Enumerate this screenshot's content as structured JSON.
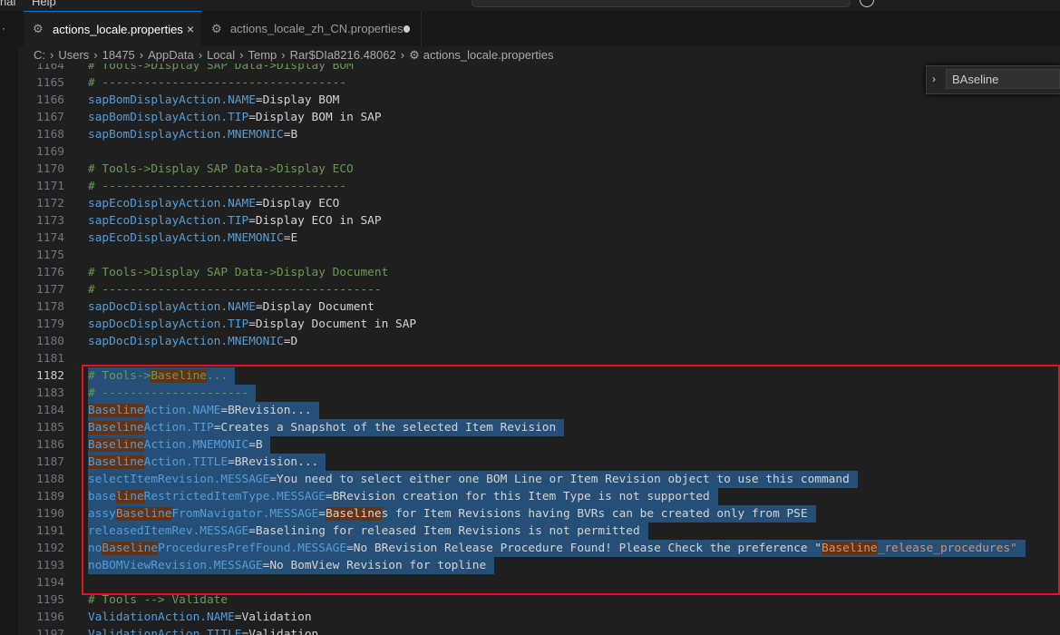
{
  "menu": {
    "items": [
      "nal",
      "Help"
    ]
  },
  "tabs": [
    {
      "label": "actions_locale.properties",
      "active": true,
      "close": "×"
    },
    {
      "label": "actions_locale_zh_CN.properties",
      "active": false,
      "modified": true
    }
  ],
  "breadcrumb": [
    "C:",
    "Users",
    "18475",
    "AppData",
    "Local",
    "Temp",
    "Rar$DIa8216.48062",
    "actions_locale.properties"
  ],
  "find": {
    "value": "BAseline",
    "chevron": "›"
  },
  "editor": {
    "current_line": "1182",
    "lines": [
      {
        "n": "1164",
        "kind": "comment",
        "text": "# Tools->Display SAP Data->Display BOM"
      },
      {
        "n": "1165",
        "kind": "comment",
        "text": "# -----------------------------------"
      },
      {
        "n": "1166",
        "kind": "prop",
        "key": "sapBomDisplayAction",
        "attr": ".NAME",
        "val": "Display BOM"
      },
      {
        "n": "1167",
        "kind": "prop",
        "key": "sapBomDisplayAction",
        "attr": ".TIP",
        "val": "Display BOM in SAP"
      },
      {
        "n": "1168",
        "kind": "prop",
        "key": "sapBomDisplayAction",
        "attr": ".MNEMONIC",
        "val": "B"
      },
      {
        "n": "1169",
        "kind": "blank",
        "text": ""
      },
      {
        "n": "1170",
        "kind": "comment",
        "text": "# Tools->Display SAP Data->Display ECO"
      },
      {
        "n": "1171",
        "kind": "comment",
        "text": "# -----------------------------------"
      },
      {
        "n": "1172",
        "kind": "prop",
        "key": "sapEcoDisplayAction",
        "attr": ".NAME",
        "val": "Display ECO"
      },
      {
        "n": "1173",
        "kind": "prop",
        "key": "sapEcoDisplayAction",
        "attr": ".TIP",
        "val": "Display ECO in SAP"
      },
      {
        "n": "1174",
        "kind": "prop",
        "key": "sapEcoDisplayAction",
        "attr": ".MNEMONIC",
        "val": "E"
      },
      {
        "n": "1175",
        "kind": "blank",
        "text": ""
      },
      {
        "n": "1176",
        "kind": "comment",
        "text": "# Tools->Display SAP Data->Display Document"
      },
      {
        "n": "1177",
        "kind": "comment",
        "text": "# ----------------------------------------"
      },
      {
        "n": "1178",
        "kind": "prop",
        "key": "sapDocDisplayAction",
        "attr": ".NAME",
        "val": "Display Document"
      },
      {
        "n": "1179",
        "kind": "prop",
        "key": "sapDocDisplayAction",
        "attr": ".TIP",
        "val": "Display Document in SAP"
      },
      {
        "n": "1180",
        "kind": "prop",
        "key": "sapDocDisplayAction",
        "attr": ".MNEMONIC",
        "val": "D"
      },
      {
        "n": "1181",
        "kind": "blank",
        "text": ""
      },
      {
        "n": "1182",
        "kind": "sel",
        "segs": [
          [
            "cm",
            "# Tools->"
          ],
          [
            "cmh",
            "Baseline"
          ],
          [
            "cm",
            "..."
          ]
        ]
      },
      {
        "n": "1183",
        "kind": "sel",
        "segs": [
          [
            "cm",
            "# ---------------------"
          ]
        ]
      },
      {
        "n": "1184",
        "kind": "sel",
        "segs": [
          [
            "keyh",
            "Baseline"
          ],
          [
            "key",
            "Action.NAME"
          ],
          [
            "val",
            "=BRevision..."
          ]
        ]
      },
      {
        "n": "1185",
        "kind": "sel",
        "segs": [
          [
            "keyh",
            "Baseline"
          ],
          [
            "key",
            "Action.TIP"
          ],
          [
            "val",
            "=Creates a Snapshot of the selected Item Revision"
          ]
        ]
      },
      {
        "n": "1186",
        "kind": "sel",
        "segs": [
          [
            "keyh",
            "Baseline"
          ],
          [
            "key",
            "Action.MNEMONIC"
          ],
          [
            "val",
            "=B"
          ]
        ]
      },
      {
        "n": "1187",
        "kind": "sel",
        "segs": [
          [
            "keyh",
            "Baseline"
          ],
          [
            "key",
            "Action.TITLE"
          ],
          [
            "val",
            "=BRevision..."
          ]
        ]
      },
      {
        "n": "1188",
        "kind": "sel",
        "segs": [
          [
            "key",
            "selectItemRevision.MESSAGE"
          ],
          [
            "val",
            "=You need to select either one BOM Line or Item Revision object to use this command"
          ]
        ]
      },
      {
        "n": "1189",
        "kind": "sel",
        "segs": [
          [
            "key",
            "base"
          ],
          [
            "keyh",
            "line"
          ],
          [
            "key",
            "RestrictedItemType.MESSAGE"
          ],
          [
            "val",
            "=BRevision creation for this Item Type is not supported"
          ]
        ]
      },
      {
        "n": "1190",
        "kind": "sel",
        "segs": [
          [
            "key",
            "assy"
          ],
          [
            "keyh",
            "Baseline"
          ],
          [
            "key",
            "FromNavigator.MESSAGE"
          ],
          [
            "val",
            "="
          ],
          [
            "valh",
            "Baseline"
          ],
          [
            "val",
            "s for Item Revisions having BVRs can be created only from PSE"
          ]
        ]
      },
      {
        "n": "1191",
        "kind": "sel",
        "segs": [
          [
            "key",
            "releasedItemRev.MESSAGE"
          ],
          [
            "val",
            "=Baselining for released Item Revisions is not permitted"
          ]
        ]
      },
      {
        "n": "1192",
        "kind": "sel",
        "segs": [
          [
            "key",
            "no"
          ],
          [
            "keyh",
            "Baseline"
          ],
          [
            "key",
            "ProceduresPrefFound.MESSAGE"
          ],
          [
            "val",
            "=No BRevision Release Procedure Found! Please Check the preference \""
          ],
          [
            "strh",
            "Baseline"
          ],
          [
            "str",
            "_release_procedures\""
          ]
        ]
      },
      {
        "n": "1193",
        "kind": "sel",
        "segs": [
          [
            "key",
            "noBOMViewRevision.MESSAGE"
          ],
          [
            "val",
            "=No BomView Revision for topline"
          ]
        ]
      },
      {
        "n": "1194",
        "kind": "blank",
        "text": ""
      },
      {
        "n": "1195",
        "kind": "comment",
        "text": "# Tools --> Validate"
      },
      {
        "n": "1196",
        "kind": "prop",
        "key": "ValidationAction",
        "attr": ".NAME",
        "val": "Validation"
      },
      {
        "n": "1197",
        "kind": "prop",
        "key": "ValidationAction",
        "attr": ".TITLE",
        "val": "Validation"
      }
    ]
  },
  "colors": {
    "accent": "#0078d4",
    "selection": "#264f78",
    "match": "#623315",
    "annotation": "#e0161e"
  }
}
